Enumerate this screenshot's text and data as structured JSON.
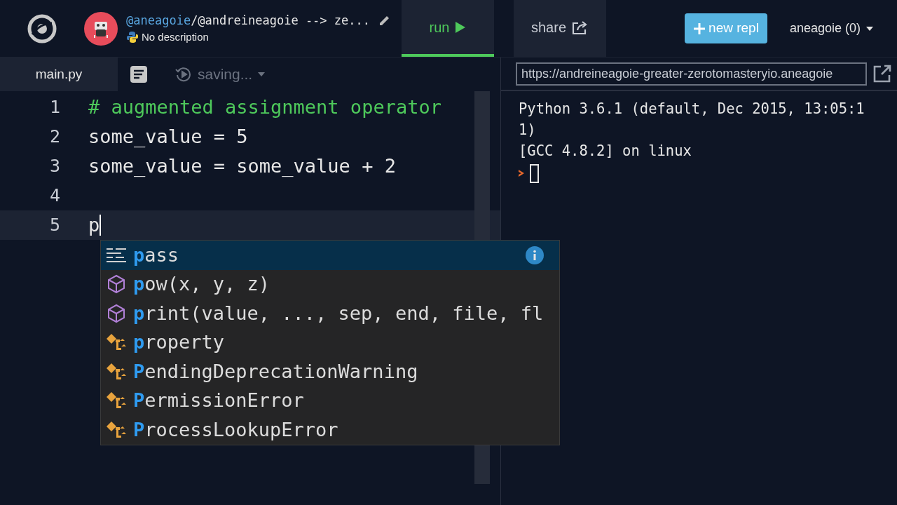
{
  "header": {
    "owner": "@aneagoie",
    "title": "/@andreineagoie --> ze...",
    "description": "No description",
    "tabs": [
      {
        "label": "run",
        "kind": "run",
        "selected": true
      },
      {
        "label": "share",
        "kind": "share",
        "selected": false
      }
    ],
    "new_button": "new repl",
    "user": "aneagoie (0)"
  },
  "editor": {
    "file_tab": "main.py",
    "status": "saving...",
    "lines": [
      {
        "number": "1",
        "text": "# augmented assignment operator",
        "kind": "comment",
        "current": false
      },
      {
        "number": "2",
        "text": "some_value = 5",
        "kind": "code",
        "current": false
      },
      {
        "number": "3",
        "text": "some_value = some_value + 2",
        "kind": "code",
        "current": false
      },
      {
        "number": "4",
        "current": false
      },
      {
        "number": "5",
        "text": "p",
        "kind": "code",
        "current": true
      }
    ],
    "completions": [
      {
        "match": "p",
        "rest": "ass",
        "kind": "keyword",
        "selected": true
      },
      {
        "match": "p",
        "rest": "ow(x, y, z)",
        "kind": "function",
        "selected": false
      },
      {
        "match": "p",
        "rest": "rint(value, ..., sep, end, file, fl",
        "kind": "function",
        "selected": false
      },
      {
        "match": "p",
        "rest": "roperty",
        "kind": "class",
        "selected": false
      },
      {
        "match": "P",
        "rest": "endingDeprecationWarning",
        "kind": "class",
        "selected": false
      },
      {
        "match": "P",
        "rest": "ermissionError",
        "kind": "class",
        "selected": false
      },
      {
        "match": "P",
        "rest": "rocessLookupError",
        "kind": "class",
        "selected": false
      }
    ]
  },
  "console": {
    "url": "https://andreineagoie-greater-zerotomasteryio.aneagoie",
    "output": [
      "Python 3.6.1 (default, Dec 2015, 13:05:11)",
      "[GCC 4.8.2] on linux"
    ]
  }
}
